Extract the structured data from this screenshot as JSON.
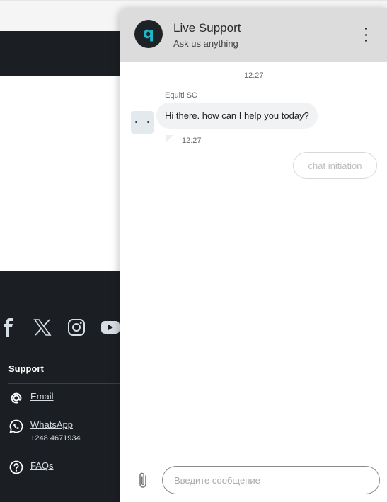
{
  "footer": {
    "social_icons": [
      "facebook-icon",
      "x-icon",
      "instagram-icon",
      "youtube-icon"
    ],
    "support_title": "Support",
    "links": [
      {
        "label": "Email",
        "icon": "at-icon"
      },
      {
        "label": "WhatsApp",
        "icon": "whatsapp-icon",
        "sub": "+248 4671934"
      },
      {
        "label": "FAQs",
        "icon": "question-icon"
      }
    ]
  },
  "chat": {
    "title": "Live Support",
    "subtitle": "Ask us anything",
    "timestamp_top": "12:27",
    "sender": "Equiti SC",
    "message": "Hi there. how can I help you today?",
    "message_time": "12:27",
    "chip_label": "chat initiation",
    "input_placeholder": "Введите сообщение",
    "logo_letter": "q"
  },
  "colors": {
    "dark_bg": "#1b1f23",
    "header_bg": "#dcdcdc",
    "logo_accent": "#1fb6c9",
    "bubble_bg": "#f1f2f3"
  }
}
